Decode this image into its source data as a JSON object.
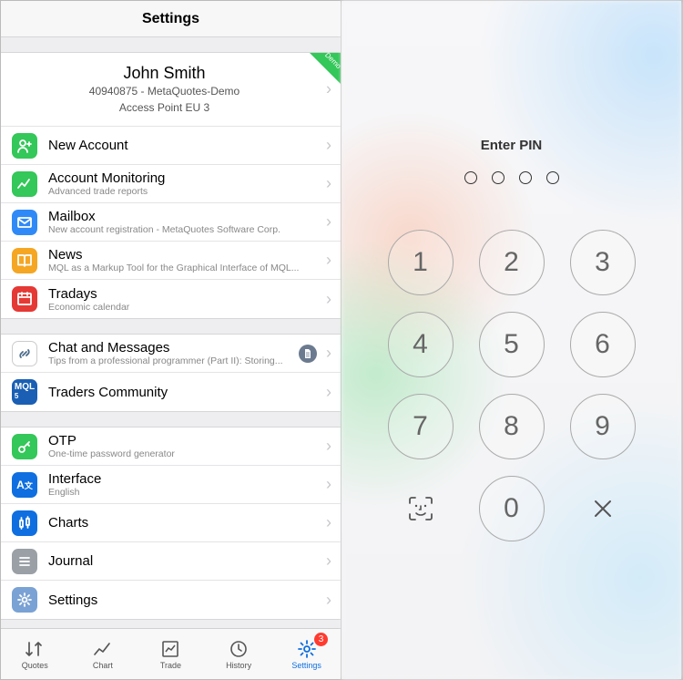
{
  "nav": {
    "title": "Settings"
  },
  "account": {
    "name": "John Smith",
    "detail1": "40940875 - MetaQuotes-Demo",
    "detail2": "Access Point EU 3",
    "ribbon": "Demo"
  },
  "sections": {
    "a": [
      {
        "icon": "person-plus-icon",
        "color": "#34c759",
        "title": "New Account",
        "sub": ""
      },
      {
        "icon": "chart-line-icon",
        "color": "#34c759",
        "title": "Account Monitoring",
        "sub": "Advanced trade reports"
      },
      {
        "icon": "mail-icon",
        "color": "#2f8af7",
        "title": "Mailbox",
        "sub": "New account registration - MetaQuotes Software Corp."
      },
      {
        "icon": "book-icon",
        "color": "#f5a623",
        "title": "News",
        "sub": "MQL as a Markup Tool for the Graphical Interface of MQL..."
      },
      {
        "icon": "calendar-icon",
        "color": "#e53935",
        "title": "Tradays",
        "sub": "Economic calendar"
      }
    ],
    "b": [
      {
        "icon": "link-icon",
        "color": "#ffffff",
        "title": "Chat and Messages",
        "sub": "Tips from a professional programmer (Part II): Storing...",
        "badge": "doc"
      },
      {
        "icon": "mql-icon",
        "color": "#1a5fb4",
        "title": "Traders Community",
        "sub": ""
      }
    ],
    "c": [
      {
        "icon": "key-icon",
        "color": "#34c759",
        "title": "OTP",
        "sub": "One-time password generator"
      },
      {
        "icon": "globe-icon",
        "color": "#0f6fe0",
        "title": "Interface",
        "sub": "English"
      },
      {
        "icon": "candle-icon",
        "color": "#0f6fe0",
        "title": "Charts",
        "sub": ""
      },
      {
        "icon": "list-icon",
        "color": "#9aa0a6",
        "title": "Journal",
        "sub": ""
      },
      {
        "icon": "gears-icon",
        "color": "#7aa2d4",
        "title": "Settings",
        "sub": ""
      }
    ]
  },
  "tabs": [
    {
      "id": "quotes",
      "label": "Quotes"
    },
    {
      "id": "chart",
      "label": "Chart"
    },
    {
      "id": "trade",
      "label": "Trade"
    },
    {
      "id": "history",
      "label": "History"
    },
    {
      "id": "settings",
      "label": "Settings",
      "active": true,
      "badge": "3"
    }
  ],
  "lock": {
    "title": "Enter PIN",
    "dots": 4,
    "keys": [
      "1",
      "2",
      "3",
      "4",
      "5",
      "6",
      "7",
      "8",
      "9"
    ],
    "zero": "0",
    "faceid": "faceid-icon",
    "delete": "delete-icon"
  }
}
